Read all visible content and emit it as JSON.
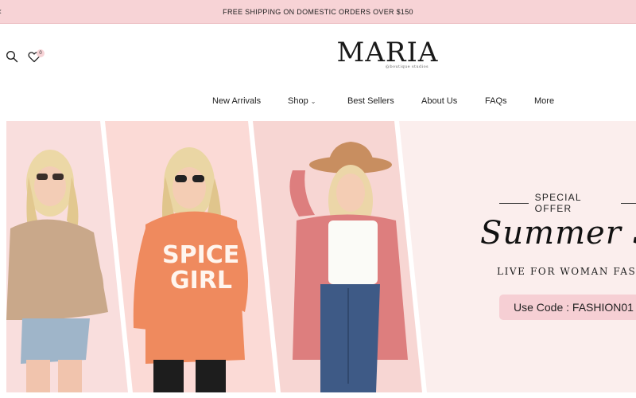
{
  "announcement": {
    "text": "FREE SHIPPING ON DOMESTIC ORDERS OVER $150",
    "prev_icon": "chevron-left-icon"
  },
  "header": {
    "search_icon": "search-icon",
    "wishlist_icon": "heart-icon",
    "wishlist_count": "0",
    "logo": {
      "name": "MARIA",
      "tagline": "@boutique studios"
    }
  },
  "nav": {
    "items": [
      {
        "label": "New Arrivals"
      },
      {
        "label": "Shop",
        "has_dropdown": true
      },
      {
        "label": "Best Sellers"
      },
      {
        "label": "About Us"
      },
      {
        "label": "FAQs"
      },
      {
        "label": "More"
      }
    ]
  },
  "hero": {
    "special_offer": "SPECIAL OFFER",
    "headline": "Summer Sa",
    "subheadline": "LIVE FOR WOMAN FASHI",
    "promo_code": "Use Code : FASHION01"
  },
  "colors": {
    "announcement_bg": "#f7d3d6",
    "hero_bg": "#fbeeed",
    "code_bg": "#f6cfd4"
  }
}
